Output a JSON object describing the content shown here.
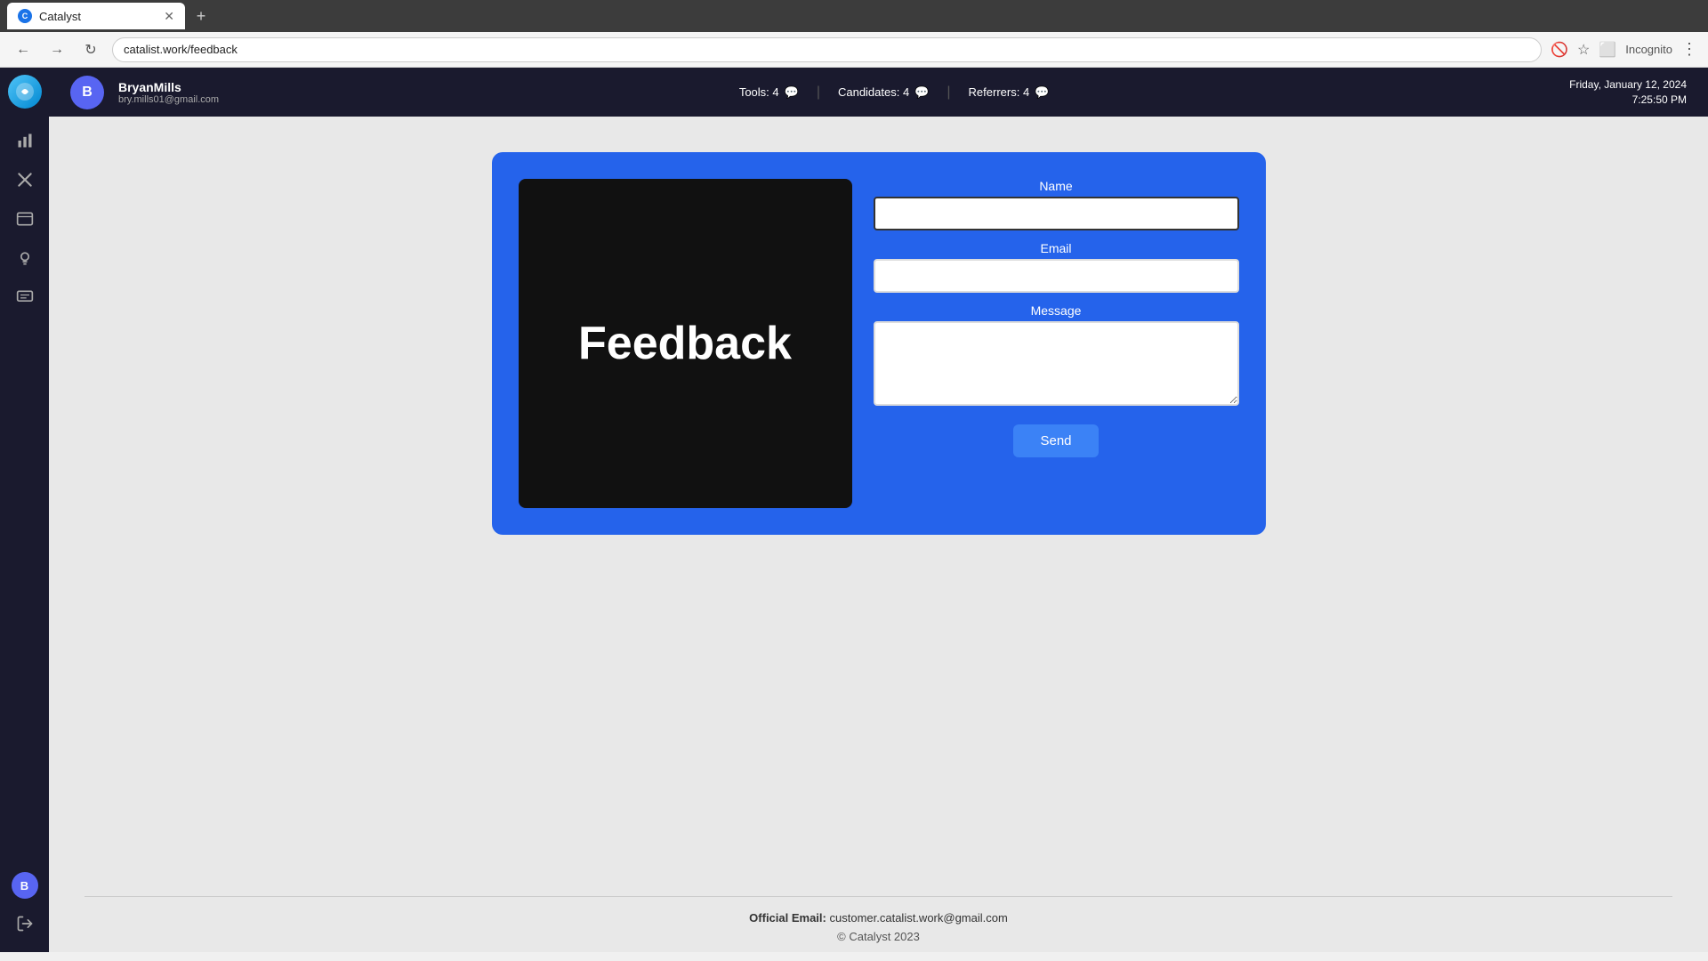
{
  "browser": {
    "tab_title": "Catalyst",
    "tab_favicon_letter": "C",
    "address": "catalist.work/feedback",
    "incognito_label": "Incognito"
  },
  "topbar": {
    "avatar_letter": "B",
    "user_name": "BryanMills",
    "user_email": "bry.mills01@gmail.com",
    "stats": {
      "tools_label": "Tools: 4",
      "candidates_label": "Candidates: 4",
      "referrers_label": "Referrers: 4"
    },
    "date": "Friday, January 12, 2024",
    "time": "7:25:50 PM"
  },
  "sidebar": {
    "logo_alt": "Catalyst Logo",
    "items": [
      {
        "name": "analytics",
        "icon": "📊"
      },
      {
        "name": "tools",
        "icon": "✂"
      },
      {
        "name": "dashboard",
        "icon": "🖥"
      },
      {
        "name": "ideas",
        "icon": "💡"
      },
      {
        "name": "messages",
        "icon": "🗒"
      }
    ],
    "bottom_avatar_letter": "B",
    "logout_icon": "→"
  },
  "feedback_form": {
    "panel_title": "Feedback",
    "name_label": "Name",
    "name_placeholder": "",
    "email_label": "Email",
    "email_placeholder": "",
    "message_label": "Message",
    "message_placeholder": "",
    "send_button": "Send"
  },
  "footer": {
    "official_email_label": "Official Email:",
    "official_email": "customer.catalist.work@gmail.com",
    "copyright": "© Catalyst 2023"
  }
}
